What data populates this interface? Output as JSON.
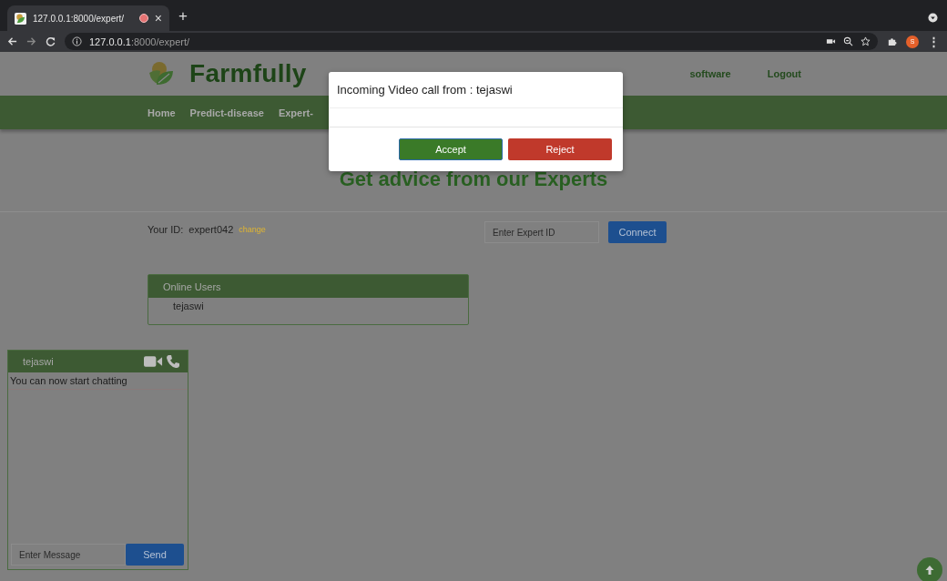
{
  "browser": {
    "tab_title": "127.0.0.1:8000/expert/",
    "close": "×",
    "new_tab": "+",
    "url_host": "127.0.0.1",
    "url_path": ":8000/expert/",
    "profile": "S",
    "menu": "⋮"
  },
  "header": {
    "brand": "Farmfully",
    "links": [
      "software",
      "Logout"
    ]
  },
  "nav": [
    "Home",
    "Predict-disease",
    "Expert-"
  ],
  "heading": "Get advice from our Experts",
  "id_row": {
    "label": "Your ID:",
    "value": "expert042",
    "change": "change"
  },
  "connect": {
    "placeholder": "Enter Expert ID",
    "button": "Connect"
  },
  "online_users": {
    "title": "Online Users",
    "users": [
      "tejaswi"
    ]
  },
  "chat": {
    "name": "tejaswi",
    "messages": [
      "You can now start chatting"
    ],
    "placeholder": "Enter Message",
    "send": "Send"
  },
  "modal": {
    "title": "Incoming Video call from : tejaswi",
    "buttons": [
      {
        "label": "Accept",
        "kind": "accept"
      },
      {
        "label": "Reject",
        "kind": "reject"
      }
    ]
  }
}
